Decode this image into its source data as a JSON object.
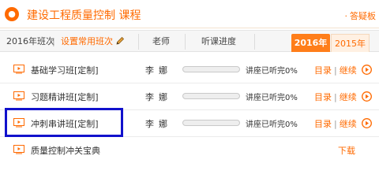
{
  "header": {
    "title": "建设工程质量控制 课程",
    "link": "答疑板",
    "link_prefix": "·",
    "accent_color": "#ff6a00"
  },
  "subheader": {
    "term_label": "2016年班次",
    "separator": "|",
    "set_common": "设置常用班次",
    "teacher_col": "老师",
    "progress_col": "听课进度",
    "tabs": [
      {
        "label": "2016年",
        "active": true
      },
      {
        "label": "2015年",
        "active": false
      }
    ]
  },
  "courses": [
    {
      "title": "基础学习班[定制]",
      "teacher": "李娜",
      "progress": 0,
      "status": "讲座已听完0%",
      "actions": [
        "目录",
        "继续"
      ]
    },
    {
      "title": "习题精讲班[定制]",
      "teacher": "李娜",
      "progress": 0,
      "status": "讲座已听完0%",
      "actions": [
        "目录",
        "继续"
      ]
    },
    {
      "title": "冲刺串讲班[定制]",
      "teacher": "李娜",
      "progress": 0,
      "status": "讲座已听完0%",
      "actions": [
        "目录",
        "继续"
      ]
    },
    {
      "title": "质量控制冲关宝典",
      "download": "下载"
    }
  ]
}
